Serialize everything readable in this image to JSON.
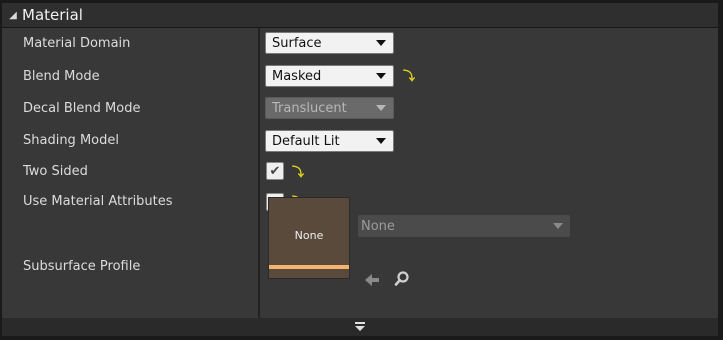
{
  "section": {
    "title": "Material",
    "collapse_icon": "triangle-down-icon"
  },
  "properties": [
    {
      "label": "Material Domain",
      "value": "Surface",
      "enabled": true,
      "reset": false
    },
    {
      "label": "Blend Mode",
      "value": "Masked",
      "enabled": true,
      "reset": true
    },
    {
      "label": "Decal Blend Mode",
      "value": "Translucent",
      "enabled": false,
      "reset": false
    },
    {
      "label": "Shading Model",
      "value": "Default Lit",
      "enabled": true,
      "reset": false
    },
    {
      "label": "Two Sided",
      "checked": true,
      "reset": true
    },
    {
      "label": "Use Material Attributes",
      "checked": true,
      "reset": true
    },
    {
      "label": "Subsurface Profile"
    }
  ],
  "subsurface": {
    "thumbnail_text": "None",
    "asset_value": "None",
    "buttons": [
      "back-arrow-icon",
      "search-icon"
    ]
  },
  "reset_icon": "reset-to-default-icon",
  "colors": {
    "reset": "#e3d21a",
    "thumbnail_bar": "#f4b36e",
    "thumbnail_bg": "#5a4a3c"
  }
}
